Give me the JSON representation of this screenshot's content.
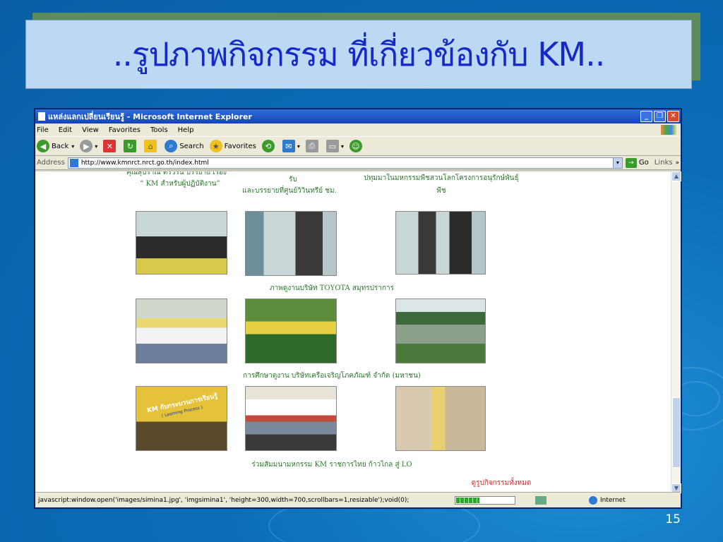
{
  "slide": {
    "title": "..รูปภาพกิจกรรม ที่เกี่ยวข้องกับ KM..",
    "page_number": "15"
  },
  "window": {
    "title": "แหล่งแลกเปลี่ยนเรียนรู้ - Microsoft Internet Explorer"
  },
  "menu": [
    "File",
    "Edit",
    "View",
    "Favorites",
    "Tools",
    "Help"
  ],
  "toolbar": {
    "back": "Back",
    "search": "Search",
    "favorites": "Favorites"
  },
  "address": {
    "label": "Address",
    "url": "http://www.kmnrct.nrct.go.th/index.html",
    "go": "Go",
    "links": "Links"
  },
  "page": {
    "top_left_caption_1": "คุณสุปราณี ตรีวิริน บรรยาย เรื่อง",
    "top_left_caption_2": "“ KM สำหรับผู้ปฏิบัติงาน”",
    "top_mid_caption_1": "รับ",
    "top_mid_caption_2": "และบรรยายที่ศูนย์วิวินทรีย์ ชม.",
    "top_right_caption_1": "ปทุมมาในมหกรรมพืชสวนโลกโครงการอนุรักษ์พันธุ์",
    "top_right_caption_2": "พืช",
    "row1_caption": "ภาพดูงานบริษัท TOYOTA สมุทรปราการ",
    "row2_caption": "การศึกษาดูงาน บริษัทเครือเจริญโภคภัณฑ์ จำกัด (มหาชน)",
    "row3_caption": "ร่วมสัมมนามหกรรม KM ราชการไทย ก้าวไกล สู่ LO",
    "all_link": "ดูรูปกิจกรรมทั้งหมด",
    "banner_text": "KM กับกระบวนการเรียนรู้",
    "banner_sub": "( Learning Process )"
  },
  "status": {
    "text": "javascript:window.open('images/simina1.jpg', 'imgsimina1', 'height=300,width=700,scrollbars=1,resizable');void(0);",
    "zone": "Internet",
    "progress": 0.4
  }
}
